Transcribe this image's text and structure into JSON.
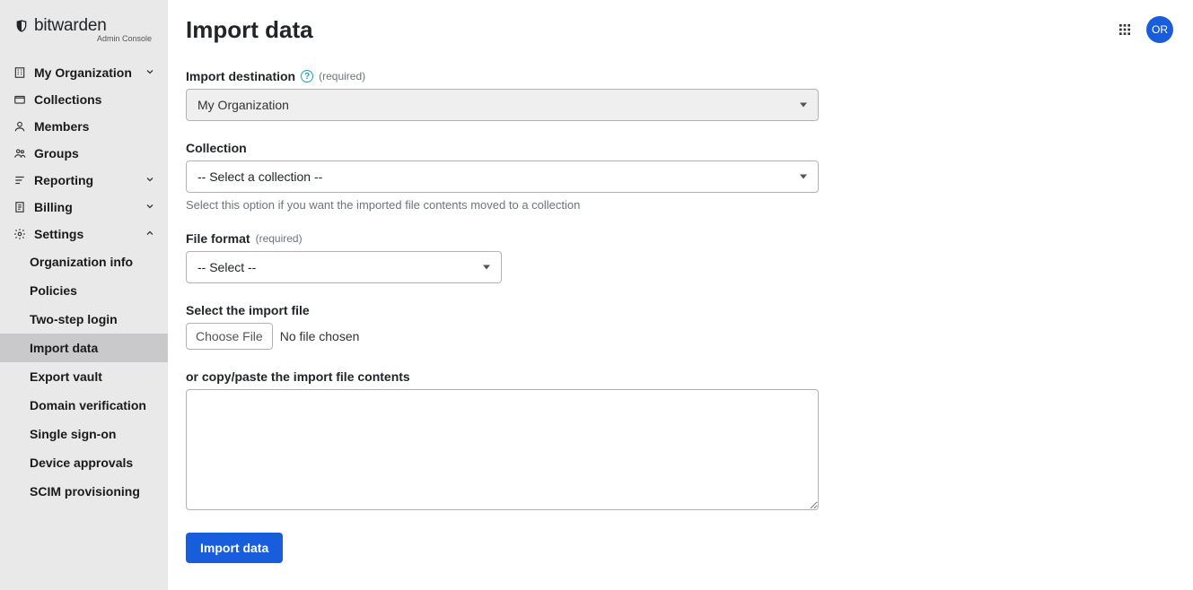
{
  "brand": {
    "name": "bitwarden",
    "sub": "Admin Console"
  },
  "sidebar": {
    "items": [
      {
        "label": "My Organization",
        "icon": "building-icon",
        "expandable": true,
        "expanded": false
      },
      {
        "label": "Collections",
        "icon": "folder-icon",
        "expandable": false
      },
      {
        "label": "Members",
        "icon": "user-icon",
        "expandable": false
      },
      {
        "label": "Groups",
        "icon": "users-icon",
        "expandable": false
      },
      {
        "label": "Reporting",
        "icon": "bars-icon",
        "expandable": true,
        "expanded": false
      },
      {
        "label": "Billing",
        "icon": "receipt-icon",
        "expandable": true,
        "expanded": false
      },
      {
        "label": "Settings",
        "icon": "gear-icon",
        "expandable": true,
        "expanded": true
      }
    ],
    "settingsSub": [
      {
        "label": "Organization info",
        "active": false
      },
      {
        "label": "Policies",
        "active": false
      },
      {
        "label": "Two-step login",
        "active": false
      },
      {
        "label": "Import data",
        "active": true
      },
      {
        "label": "Export vault",
        "active": false
      },
      {
        "label": "Domain verification",
        "active": false
      },
      {
        "label": "Single sign-on",
        "active": false
      },
      {
        "label": "Device approvals",
        "active": false
      },
      {
        "label": "SCIM provisioning",
        "active": false
      }
    ]
  },
  "header": {
    "title": "Import data",
    "avatarInitials": "OR"
  },
  "form": {
    "destination": {
      "label": "Import destination",
      "required": "(required)",
      "value": "My Organization"
    },
    "collection": {
      "label": "Collection",
      "value": "-- Select a collection --",
      "helper": "Select this option if you want the imported file contents moved to a collection"
    },
    "fileFormat": {
      "label": "File format",
      "required": "(required)",
      "value": "-- Select --"
    },
    "fileSelect": {
      "label": "Select the import file",
      "buttonLabel": "Choose File",
      "status": "No file chosen"
    },
    "paste": {
      "label": "or copy/paste the import file contents",
      "value": ""
    },
    "submitLabel": "Import data"
  }
}
